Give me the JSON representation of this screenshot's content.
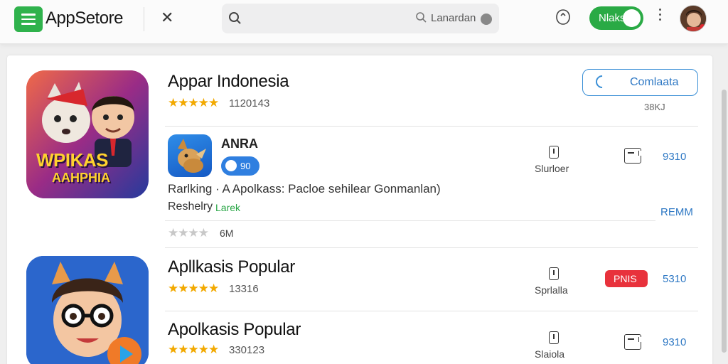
{
  "header": {
    "brand": "AppSetore",
    "search_hint": "Lanardan",
    "toggle_label": "Nlaks"
  },
  "featured": {
    "title": "Appar Indonesia",
    "stars": "★★★★★",
    "rating": "1120143",
    "button_label": "Comlaata",
    "size": "38KJ",
    "icon_text_1": "WPIKAS",
    "icon_text_2": "AAHPHIA"
  },
  "sub_app": {
    "title": "ANRA",
    "chip_label": "90",
    "description": "Rarlking · A Apolkass: Pacloe sehilear Gonmanlan)",
    "meta_label": "Reshelry",
    "meta_link": "Larek",
    "col1_label": "Slurloer",
    "price": "9310",
    "action": "REMM",
    "gray_stars": "★★★★",
    "gray_count": "6M"
  },
  "list": [
    {
      "title": "Apllkasis Popular",
      "stars": "★★★★★",
      "rating": "13316",
      "col_label": "Sprlalla",
      "badge": "PNIS",
      "price": "5310"
    },
    {
      "title": "Apolkasis Popular",
      "stars": "★★★★★",
      "rating": "330123",
      "col_label": "Slaiola",
      "price": "9310"
    }
  ],
  "colors": {
    "green": "#2fb24c",
    "blue": "#2e78c4",
    "red": "#e8323c",
    "star": "#f2a900"
  },
  "icons": [
    "menu-icon",
    "close-icon",
    "search-icon",
    "notification-icon",
    "more-icon",
    "info-icon",
    "document-icon"
  ]
}
